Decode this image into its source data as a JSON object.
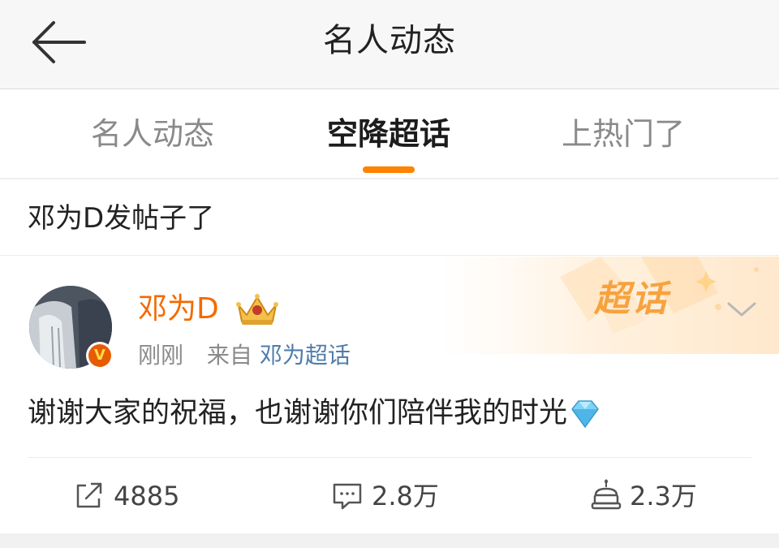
{
  "header": {
    "title": "名人动态",
    "back_icon": "arrow-left-icon"
  },
  "tabs": [
    {
      "label": "名人动态",
      "active": false
    },
    {
      "label": "空降超话",
      "active": true
    },
    {
      "label": "上热门了",
      "active": false
    }
  ],
  "accent_color": "#ff8200",
  "section": {
    "label": "邓为D发帖子了"
  },
  "post": {
    "username": "邓为D",
    "verified_badge": "V",
    "time": "刚刚",
    "source_prefix": "来自",
    "source": "邓为超话",
    "badge": "超话",
    "text": "谢谢大家的祝福，也谢谢你们陪伴我的时光",
    "actions": {
      "repost": "4885",
      "comment": "2.8万",
      "like": "2.3万"
    }
  }
}
